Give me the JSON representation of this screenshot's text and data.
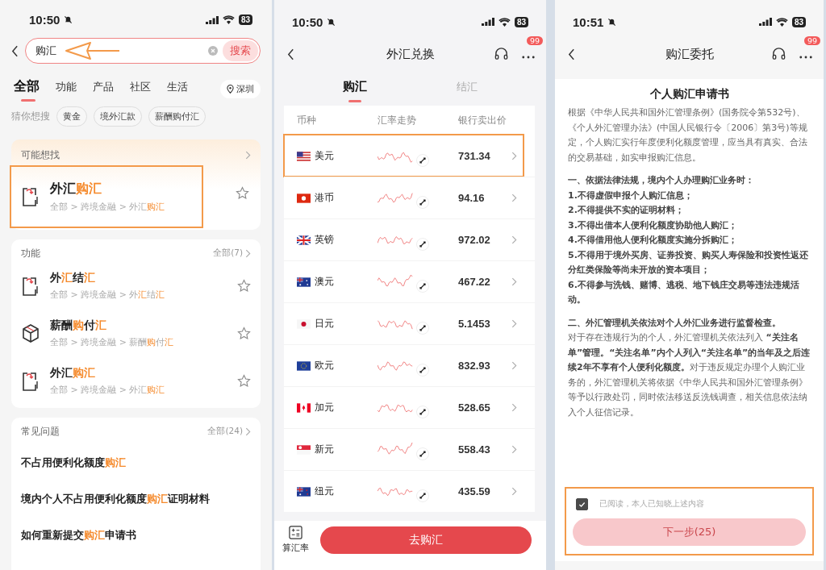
{
  "search_screen": {
    "status_bar": {
      "time": "10:50",
      "battery": "83"
    },
    "search": {
      "value": "购汇",
      "button": "搜索",
      "arrow_marked": true
    },
    "tabs": [
      {
        "label": "全部",
        "selected": true
      },
      {
        "label": "功能",
        "selected": false
      },
      {
        "label": "产品",
        "selected": false
      },
      {
        "label": "社区",
        "selected": false
      },
      {
        "label": "生活",
        "selected": false
      }
    ],
    "location": "深圳",
    "suggestions": {
      "label": "猜你想搜",
      "chips": [
        "黄金",
        "境外汇款",
        "薪酬购付汇"
      ]
    },
    "maybe_looking": {
      "title": "可能想找",
      "items": [
        {
          "outlined": true,
          "title": [
            {
              "text": "外汇",
              "highlight": false
            },
            {
              "text": "购汇",
              "highlight": true
            }
          ],
          "path": [
            {
              "text": "全部 > 跨境金融 > 外汇",
              "highlight": false
            },
            {
              "text": "购汇",
              "highlight": true
            }
          ]
        }
      ]
    },
    "functions": {
      "title": "功能",
      "more": "全部(7)",
      "items": [
        {
          "outlined": false,
          "title": [
            {
              "text": "外",
              "highlight": false
            },
            {
              "text": "汇",
              "highlight": true
            },
            {
              "text": "结",
              "highlight": false
            },
            {
              "text": "汇",
              "highlight": true
            }
          ],
          "path": [
            {
              "text": "全部 > 跨境金融 > 外",
              "highlight": false
            },
            {
              "text": "汇",
              "highlight": true
            },
            {
              "text": "结",
              "highlight": false
            },
            {
              "text": "汇",
              "highlight": true
            }
          ]
        },
        {
          "outlined": false,
          "title": [
            {
              "text": "薪酬",
              "highlight": false
            },
            {
              "text": "购",
              "highlight": true
            },
            {
              "text": "付",
              "highlight": false
            },
            {
              "text": "汇",
              "highlight": true
            }
          ],
          "path": [
            {
              "text": "全部 > 跨境金融 > 薪酬",
              "highlight": false
            },
            {
              "text": "购",
              "highlight": true
            },
            {
              "text": "付",
              "highlight": false
            },
            {
              "text": "汇",
              "highlight": true
            }
          ]
        },
        {
          "outlined": false,
          "title": [
            {
              "text": "外汇",
              "highlight": false
            },
            {
              "text": "购汇",
              "highlight": true
            }
          ],
          "path": [
            {
              "text": "全部 > 跨境金融 > 外汇",
              "highlight": false
            },
            {
              "text": "购汇",
              "highlight": true
            }
          ]
        }
      ]
    },
    "faq": {
      "title": "常见问题",
      "more": "全部(24)",
      "items": [
        [
          {
            "text": "不占用便利化额度",
            "highlight": false
          },
          {
            "text": "购汇",
            "highlight": true
          }
        ],
        [
          {
            "text": "境内个人不占用便利化额度",
            "highlight": false
          },
          {
            "text": "购汇",
            "highlight": true
          },
          {
            "text": "证明材料",
            "highlight": false
          }
        ],
        [
          {
            "text": "如何重新提交",
            "highlight": false
          },
          {
            "text": "购汇",
            "highlight": true
          },
          {
            "text": "申请书",
            "highlight": false
          }
        ]
      ]
    }
  },
  "exchange_screen": {
    "status_bar": {
      "time": "10:50",
      "battery": "83"
    },
    "title": "外汇兑换",
    "badge": "99",
    "tabs": [
      {
        "label": "购汇",
        "selected": true
      },
      {
        "label": "结汇",
        "selected": false
      }
    ],
    "columns": [
      "币种",
      "汇率走势",
      "银行卖出价"
    ],
    "rows": [
      {
        "currency": "美元",
        "price": "731.34",
        "outlined": true
      },
      {
        "currency": "港币",
        "price": "94.16",
        "outlined": false
      },
      {
        "currency": "英镑",
        "price": "972.02",
        "outlined": false
      },
      {
        "currency": "澳元",
        "price": "467.22",
        "outlined": false
      },
      {
        "currency": "日元",
        "price": "5.1453",
        "outlined": false
      },
      {
        "currency": "欧元",
        "price": "832.93",
        "outlined": false
      },
      {
        "currency": "加元",
        "price": "528.65",
        "outlined": false
      },
      {
        "currency": "新元",
        "price": "558.43",
        "outlined": false
      },
      {
        "currency": "纽元",
        "price": "435.59",
        "outlined": false
      }
    ],
    "calculator_label": "算汇率",
    "button": "去购汇"
  },
  "application_screen": {
    "status_bar": {
      "time": "10:51",
      "battery": "83"
    },
    "title": "购汇委托",
    "badge": "99",
    "document": {
      "title": "个人购汇申请书",
      "paragraphs": [
        {
          "kind": "normal",
          "text": "根据《中华人民共和国外汇管理条例》(国务院令第532号)、《个人外汇管理办法》(中国人民银行令〔2006〕第3号)等规定，个人购汇实行年度便利化额度管理，应当具有真实、合法的交易基础，如实申报购汇信息。"
        },
        {
          "kind": "section",
          "text": "一、依据法律法规，境内个人办理购汇业务时："
        },
        {
          "kind": "bold",
          "text": "1.不得虚假申报个人购汇信息；"
        },
        {
          "kind": "bold",
          "text": "2.不得提供不实的证明材料；"
        },
        {
          "kind": "bold",
          "text": "3.不得出借本人便利化额度协助他人购汇；"
        },
        {
          "kind": "bold",
          "text": "4.不得借用他人便利化额度实施分拆购汇；"
        },
        {
          "kind": "bold",
          "text": "5.不得用于境外买房、证券投资、购买人寿保险和投资性返还分红类保险等尚未开放的资本项目；"
        },
        {
          "kind": "bold",
          "text": "6.不得参与洗钱、赌博、逃税、地下钱庄交易等违法违规活动。"
        },
        {
          "kind": "section",
          "text": "二、外汇管理机关依法对个人外汇业务进行监督检查。"
        },
        {
          "kind": "normal",
          "text": "对于存在违规行为的个人，外汇管理机关依法列入 **“关注名单”管理。“关注名单”内个人列入“关注名单”的当年及之后连续2年不享有个人便利化额度。**对于违反规定办理个人购汇业务的，外汇管理机关将依据《中华人民共和国外汇管理条例》等予以行政处罚，同时依法移送反洗钱调查，相关信息依法纳入个人征信记录。"
        }
      ]
    },
    "agreement": {
      "label": "已阅读，本人已知晓上述内容",
      "checked": true
    },
    "button": {
      "label": "下一步(25)",
      "disabled": true
    },
    "footer_outlined": true
  }
}
